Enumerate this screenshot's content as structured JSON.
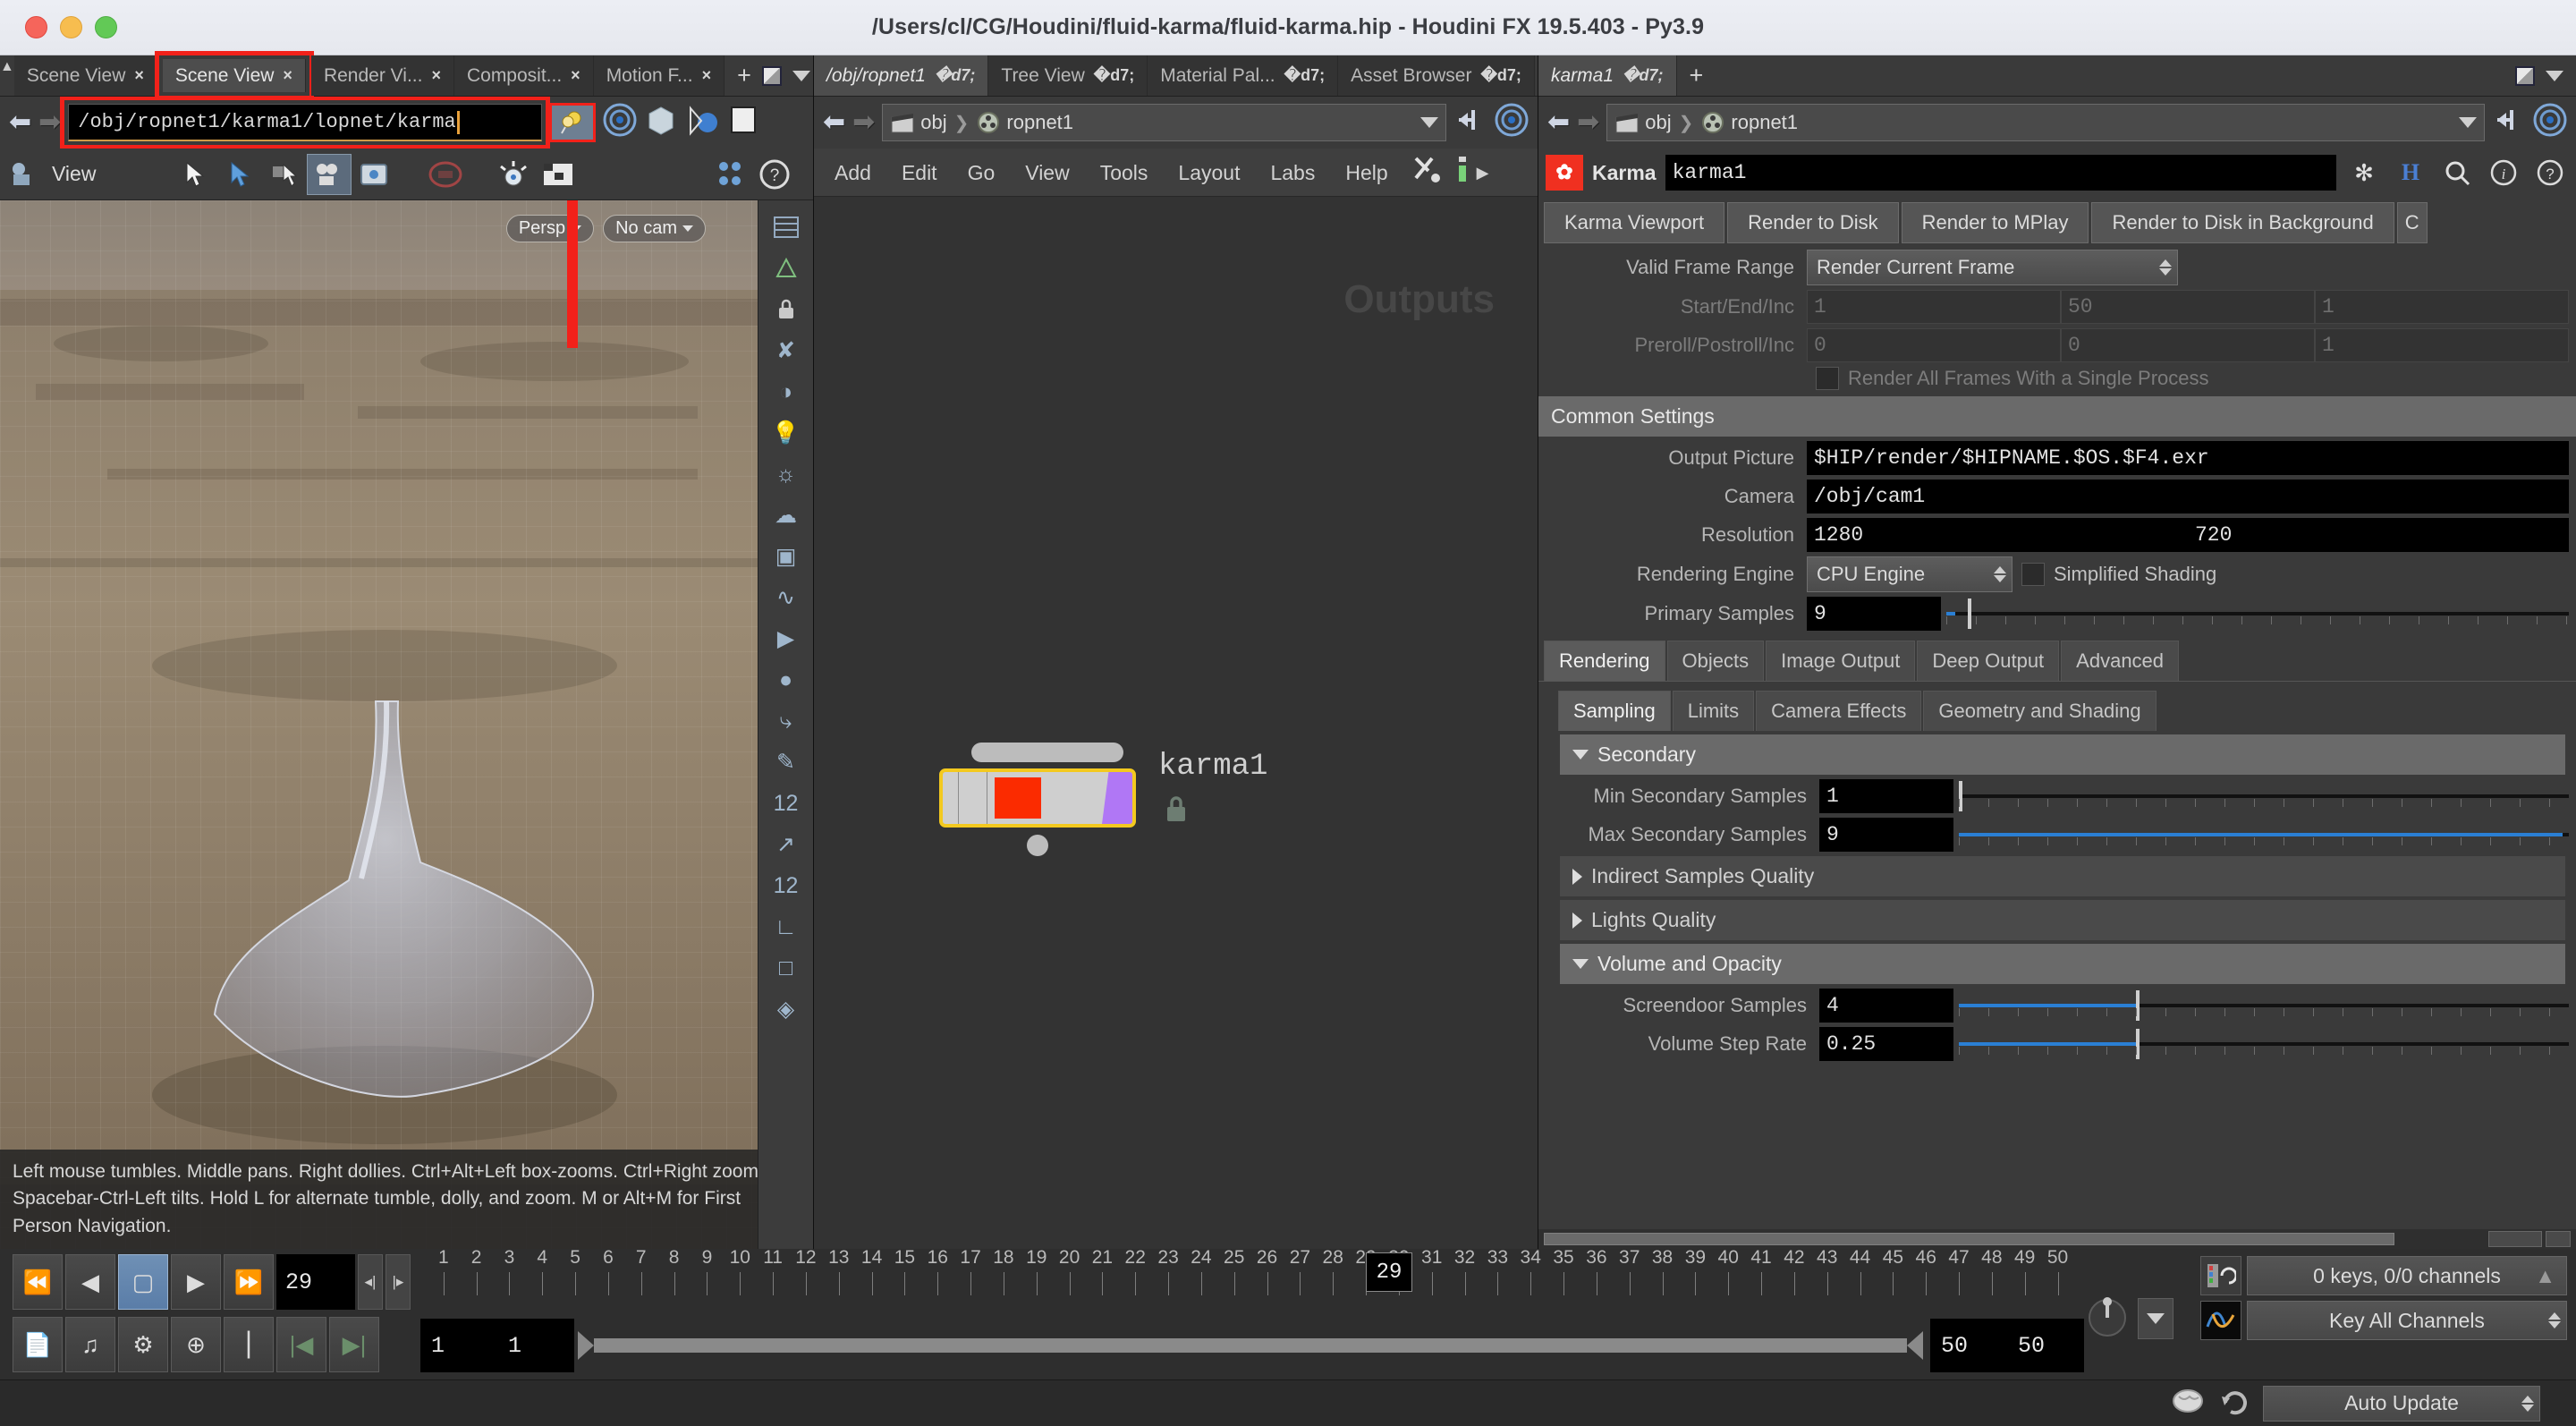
{
  "window": {
    "title": "/Users/cl/CG/Houdini/fluid-karma/fluid-karma.hip - Houdini FX 19.5.403 - Py3.9"
  },
  "left_pane": {
    "tabs": [
      {
        "label": "Scene View",
        "active": false
      },
      {
        "label": "Scene View",
        "active": true
      },
      {
        "label": "Render Vi...",
        "active": false
      },
      {
        "label": "Composit...",
        "active": false
      },
      {
        "label": "Motion F...",
        "active": false
      }
    ],
    "close_glyph": "×",
    "add_tab": "+",
    "path_value": "/obj/ropnet1/karma1/lopnet/karma",
    "toolbar": {
      "view_label": "View",
      "icons": [
        "camera-icon",
        "tumble-icon",
        "select-icon",
        "rotate-icon",
        "view-layout-icon",
        "snapshot-icon",
        "stop-icon",
        "light-icon",
        "display-options-icon",
        "users-icon",
        "help-icon"
      ]
    },
    "viewport": {
      "persp_button": "Persp",
      "cam_button": "No cam",
      "help_text": "Left mouse tumbles. Middle pans. Right dollies. Ctrl+Alt+Left box-zooms. Ctrl+Right zooms. Spacebar-Ctrl-Left tilts. Hold L for alternate tumble, dolly, and zoom.    M or Alt+M for First Person Navigation."
    }
  },
  "mid_pane": {
    "tabs": [
      {
        "label": "/obj/ropnet1",
        "active": true
      },
      {
        "label": "Tree View",
        "active": false
      },
      {
        "label": "Material Pal...",
        "active": false
      },
      {
        "label": "Asset Browser",
        "active": false
      }
    ],
    "breadcrumb": [
      "obj",
      "ropnet1"
    ],
    "menu": [
      "Add",
      "Edit",
      "Go",
      "View",
      "Tools",
      "Layout",
      "Labs",
      "Help"
    ],
    "outputs_label": "Outputs",
    "node": {
      "name": "karma1",
      "locked": true
    }
  },
  "right_pane": {
    "tabs": [
      {
        "label": "karma1",
        "active": true
      }
    ],
    "breadcrumb": [
      "obj",
      "ropnet1"
    ],
    "node_type_label": "Karma",
    "node_name": "karma1",
    "header_icons": [
      "gear-icon",
      "houdini-h-icon",
      "search-icon",
      "info-icon",
      "help-icon"
    ],
    "render_buttons": [
      "Karma Viewport",
      "Render to Disk",
      "Render to MPlay",
      "Render to Disk in Background",
      "C"
    ],
    "params": {
      "valid_frame_range_label": "Valid Frame Range",
      "valid_frame_range_value": "Render Current Frame",
      "start_end_inc_label": "Start/End/Inc",
      "start_end_inc_values": [
        "1",
        "50",
        "1"
      ],
      "preroll_label": "Preroll/Postroll/Inc",
      "preroll_values": [
        "0",
        "0",
        "1"
      ],
      "single_process_label": "Render All Frames With a Single Process",
      "common_settings_header": "Common Settings",
      "output_picture_label": "Output Picture",
      "output_picture_value": "$HIP/render/$HIPNAME.$OS.$F4.exr",
      "camera_label": "Camera",
      "camera_value": "/obj/cam1",
      "resolution_label": "Resolution",
      "resolution_values": [
        "1280",
        "720"
      ],
      "rendering_engine_label": "Rendering Engine",
      "rendering_engine_value": "CPU Engine",
      "simplified_shading_label": "Simplified Shading",
      "primary_samples_label": "Primary Samples",
      "primary_samples_value": "9"
    },
    "tabs_main": [
      {
        "label": "Rendering",
        "active": true
      },
      {
        "label": "Objects",
        "active": false
      },
      {
        "label": "Image Output",
        "active": false
      },
      {
        "label": "Deep Output",
        "active": false
      },
      {
        "label": "Advanced",
        "active": false
      }
    ],
    "tabs_sub": [
      {
        "label": "Sampling",
        "active": true
      },
      {
        "label": "Limits",
        "active": false
      },
      {
        "label": "Camera Effects",
        "active": false
      },
      {
        "label": "Geometry and Shading",
        "active": false
      }
    ],
    "secondary": {
      "header": "Secondary",
      "min_label": "Min Secondary Samples",
      "min_value": "1",
      "max_label": "Max Secondary Samples",
      "max_value": "9",
      "indirect_label": "Indirect Samples Quality",
      "lights_label": "Lights Quality"
    },
    "volume": {
      "header": "Volume and Opacity",
      "screendoor_label": "Screendoor Samples",
      "screendoor_value": "4",
      "step_rate_label": "Volume Step Rate",
      "step_rate_value": "0.25"
    }
  },
  "playbar": {
    "current_frame": "29",
    "playhead_frame": "29",
    "range_start": "1",
    "range_start2": "1",
    "range_end": "50",
    "range_end2": "50",
    "ruler_ticks": [
      "1",
      "2",
      "3",
      "4",
      "5",
      "6",
      "7",
      "8",
      "9",
      "10",
      "11",
      "12",
      "13",
      "14",
      "15",
      "16",
      "17",
      "18",
      "19",
      "20",
      "21",
      "22",
      "23",
      "24",
      "25",
      "26",
      "27",
      "28",
      "29",
      "30",
      "31",
      "32",
      "33",
      "34",
      "35",
      "36",
      "37",
      "38",
      "39",
      "40",
      "41",
      "42",
      "43",
      "44",
      "45",
      "46",
      "47",
      "48",
      "49",
      "50"
    ],
    "keys_status": "0 keys, 0/0 channels",
    "key_mode": "Key All Channels",
    "auto_update": "Auto Update",
    "transport_icons": [
      "jump-start-icon",
      "step-back-icon",
      "stop-icon",
      "play-icon",
      "jump-end-icon"
    ],
    "tool_icons": [
      "set-key-icon",
      "audio-icon",
      "ik-icon",
      "add-key-icon",
      "channel-icon",
      "prev-key-icon",
      "next-key-icon"
    ]
  },
  "colors": {
    "accent_red": "#f2211a",
    "node_select": "#f3c91f",
    "slider_blue": "#2a7fd4",
    "karma_red": "#f03020",
    "flag_purple": "#b077f5"
  }
}
